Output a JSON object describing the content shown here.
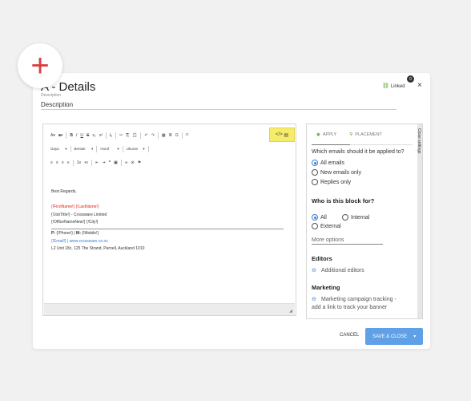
{
  "header": {
    "title": "A - Details",
    "description_label": "Description",
    "description_value": "Description",
    "linked_label": "Linked",
    "linked_badge": "0",
    "close_glyph": "×",
    "add_glyph": "+"
  },
  "toolbar": {
    "row1": [
      "A▾",
      "■▾",
      "B",
      "I",
      "U",
      "S",
      "x₂",
      "x²",
      "I̶ₓ",
      "✂",
      "⎘",
      "📋",
      "↶",
      "↷",
      "▦",
      "≣",
      "Ω",
      "⤧",
      "⇲",
      "≡"
    ],
    "font_label": "Gaya",
    "format_label": "Bentuk",
    "typeface_label": "Huruf",
    "size_label": "Ukuran",
    "row3": [
      "≡",
      "≡",
      "≡",
      "≡",
      "1≡",
      "•≡",
      "⇤",
      "⇥",
      "❞",
      "▣",
      "∞",
      "⊘",
      "⚑"
    ],
    "source_label": "</>"
  },
  "editor": {
    "greeting": "Best Regards,",
    "name_line": "{!FirstName!} {!LastName!}",
    "job_line": "{!JobTitle!} - Crossware Limited",
    "office_line": "{!OfficeNameNew!} {!City!}",
    "phone_prefix": "P:",
    "phone_line": "{!Phone!} |",
    "mobile_prefix": "M:",
    "mobile_line": "{!Mobile!}",
    "email_line": "{!Email!} | www.crossware.co.nz",
    "address_line": "L2 Unit 18c, 125 The Strand, Parnell, Auckland 1010"
  },
  "panel": {
    "tab_apply": "APPLY",
    "tab_placement": "PLACEMENT",
    "close_settings": "Close settings",
    "question1": "Which emails should it be applied to?",
    "options1": [
      "All emails",
      "New emails only",
      "Replies only"
    ],
    "question2": "Who is this block for?",
    "options2": [
      "All",
      "Internal",
      "External"
    ],
    "more_options": "More options",
    "editors_heading": "Editors",
    "editors_text": "Additional editors",
    "marketing_heading": "Marketing",
    "marketing_text1": "Marketing campaign tracking -",
    "marketing_text2": "add a link to track your banner"
  },
  "footer": {
    "cancel": "CANCEL",
    "save": "SAVE & CLOSE",
    "save_caret": "▾"
  },
  "colors": {
    "accent_blue": "#5fa0e6",
    "red_field": "#d9261c",
    "link_blue": "#3a7bd5",
    "highlight": "#f7eb6a"
  }
}
